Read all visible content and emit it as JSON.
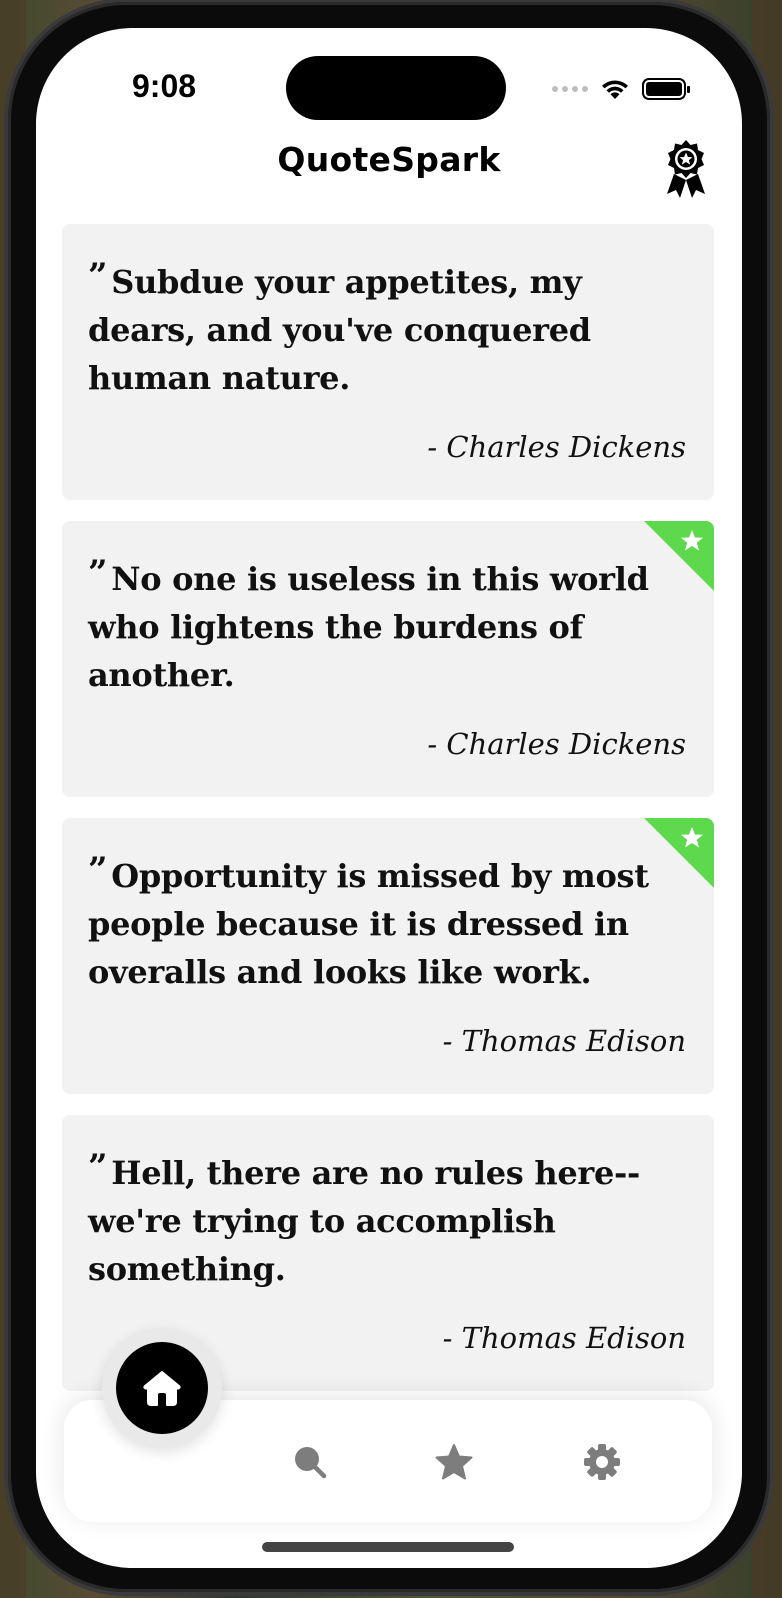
{
  "status_bar": {
    "time": "9:08"
  },
  "header": {
    "title": "QuoteSpark",
    "award_icon": "award-badge-icon"
  },
  "quotes": [
    {
      "mark": "”",
      "text": "Subdue your appetites, my dears, and you've conquered human nature.",
      "author": "- Charles Dickens",
      "favorite": false
    },
    {
      "mark": "”",
      "text": "No one is useless in this world who lightens the burdens of another.",
      "author": "- Charles Dickens",
      "favorite": true
    },
    {
      "mark": "”",
      "text": "Opportunity is missed by most people because it is dressed in overalls and looks like work.",
      "author": "- Thomas Edison",
      "favorite": true
    },
    {
      "mark": "”",
      "text": "Hell, there are no rules here-- we're trying to accomplish something.",
      "author": "- Thomas Edison",
      "favorite": false
    }
  ],
  "colors": {
    "favorite_ribbon": "#5ed84c",
    "card_bg": "#f2f2f2",
    "nav_icon": "#7d7d7d"
  },
  "bottom_nav": [
    {
      "name": "home",
      "icon": "home-icon",
      "active": true
    },
    {
      "name": "search",
      "icon": "search-icon",
      "active": false
    },
    {
      "name": "favorites",
      "icon": "star-icon",
      "active": false
    },
    {
      "name": "settings",
      "icon": "gear-icon",
      "active": false
    }
  ]
}
